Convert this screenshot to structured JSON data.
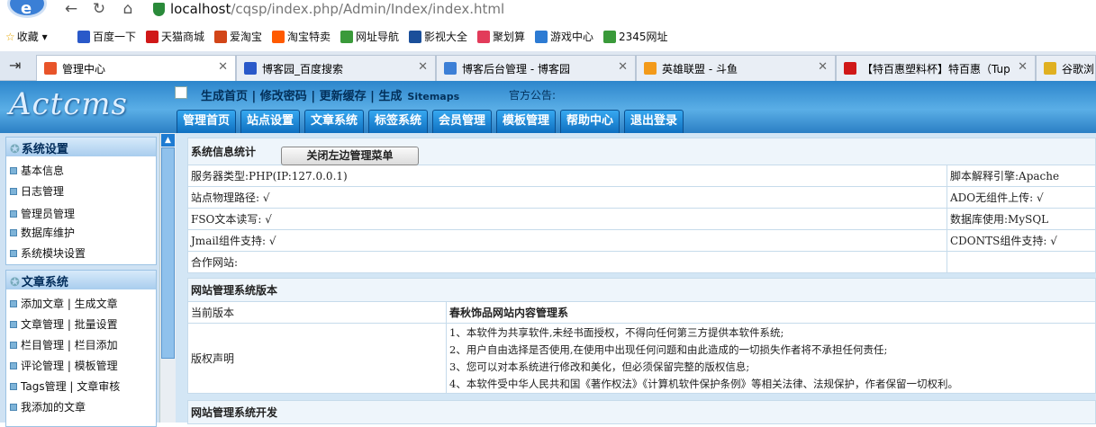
{
  "browser": {
    "url_host": "localhost",
    "url_path": "/cqsp/index.php/Admin/Index/index.html",
    "bookmarks": [
      "收藏",
      "百度一下",
      "天猫商城",
      "爱淘宝",
      "淘宝特卖",
      "网址导航",
      "影视大全",
      "聚划算",
      "游戏中心",
      "2345网址"
    ],
    "bookmark_colors": [
      "#f2b400",
      "#2a59c9",
      "#d01818",
      "#d24518",
      "#ff5a00",
      "#3a9a3a",
      "#1a4f9a",
      "#e23b5a",
      "#2d7bd3",
      "#3a9a3a"
    ],
    "tabs": [
      {
        "title": "管理中心",
        "icon_color": "#e8542a"
      },
      {
        "title": "博客园_百度搜索",
        "icon_color": "#2a59c9"
      },
      {
        "title": "博客后台管理 - 博客园",
        "icon_color": "#3c7fd6"
      },
      {
        "title": "英雄联盟 - 斗鱼",
        "icon_color": "#f39a1a"
      },
      {
        "title": "【特百惠塑料杯】特百惠（Tup",
        "icon_color": "#d01818"
      },
      {
        "title": "谷歌浏览",
        "icon_color": "#e0b020"
      }
    ]
  },
  "header": {
    "logo": "Actcms",
    "quick_links": "生成首页 | 修改密码 | 更新缓存 | 生成",
    "sitemaps": "Sitemaps",
    "notice": "官方公告:",
    "tabs": [
      "管理首页",
      "站点设置",
      "文章系统",
      "标签系统",
      "会员管理",
      "模板管理",
      "帮助中心",
      "退出登录"
    ]
  },
  "sidebar": {
    "sections": [
      {
        "title": "系统设置",
        "items": [
          "基本信息",
          "日志管理",
          "管理员管理",
          "数据库维护",
          "系统模块设置"
        ]
      },
      {
        "title": "文章系统",
        "items": [
          "添加文章 | 生成文章",
          "文章管理 | 批量设置",
          "栏目管理 | 栏目添加",
          "评论管理 | 模板管理",
          "Tags管理 | 文章审核",
          "我添加的文章"
        ]
      }
    ]
  },
  "main": {
    "info_title": "系统信息统计",
    "close_menu_button": "关闭左边管理菜单",
    "rows": [
      {
        "left": "服务器类型:PHP(IP:127.0.0.1)",
        "right": "脚本解释引擎:Apache"
      },
      {
        "left": "站点物理路径: √",
        "right": "ADO无组件上传: √"
      },
      {
        "left": "FSO文本读写: √",
        "right": "数据库使用:MySQL"
      },
      {
        "left": "Jmail组件支持: √",
        "right": "CDONTS组件支持: √"
      },
      {
        "left": "合作网站:",
        "right": ""
      }
    ],
    "version_title": "网站管理系统版本",
    "current_version_label": "当前版本",
    "current_version_value": "春秋饰品网站内容管理系",
    "copyright_label": "版权声明",
    "copyright_lines": [
      "1、本软件为共享软件,未经书面授权，不得向任何第三方提供本软件系统;",
      "2、用户自由选择是否使用,在使用中出现任何问题和由此造成的一切损失作者将不承担任何责任;",
      "3、您可以对本系统进行修改和美化，但必须保留完整的版权信息;",
      "4、本软件受中华人民共和国《著作权法》《计算机软件保护条例》等相关法律、法规保护，作者保留一切权利。"
    ],
    "dev_title": "网站管理系统开发"
  }
}
